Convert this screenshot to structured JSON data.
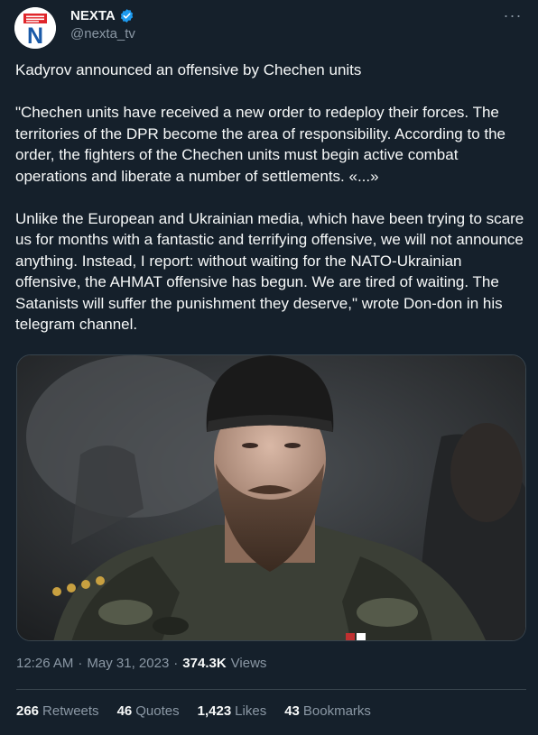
{
  "account": {
    "display_name": "NEXTA",
    "handle": "@nexta_tv",
    "verified": true,
    "avatar_letter": "N"
  },
  "more_label": "···",
  "tweet": {
    "paragraphs": [
      "Kadyrov announced an offensive by Chechen units",
      "\"Chechen units have received a new order to redeploy their forces. The territories of the DPR become the area of responsibility. According to the order, the fighters of the Chechen units must begin active combat operations and liberate a number of settlements. «...»",
      "Unlike the European and Ukrainian media, which have been trying to scare us for months with a fantastic and terrifying offensive, we will not announce anything. Instead, I report: without waiting for the NATO-Ukrainian offensive, the AHMAT offensive has begun. We are tired of waiting. The Satanists will suffer the punishment they deserve,\" wrote Don-don in his telegram channel."
    ]
  },
  "meta": {
    "time": "12:26 AM",
    "separator": "·",
    "date": "May 31, 2023",
    "views_count": "374.3K",
    "views_label": "Views"
  },
  "stats": {
    "retweets": {
      "count": "266",
      "label": "Retweets"
    },
    "quotes": {
      "count": "46",
      "label": "Quotes"
    },
    "likes": {
      "count": "1,423",
      "label": "Likes"
    },
    "bookmarks": {
      "count": "43",
      "label": "Bookmarks"
    }
  },
  "colors": {
    "background": "#15202b",
    "text": "#f7f9f9",
    "secondary": "#8b98a5",
    "border": "#38444d",
    "verified": "#1d9bf0",
    "brand_red": "#e0262b"
  }
}
